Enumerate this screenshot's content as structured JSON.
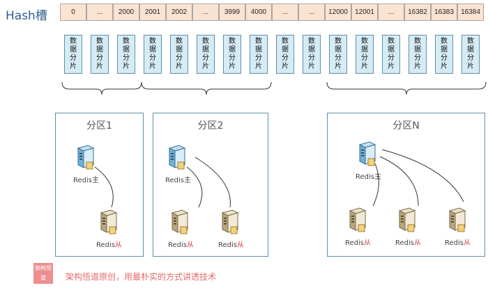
{
  "title": "Hash槽",
  "slots": [
    "0",
    "...",
    "2000",
    "2001",
    "2002",
    "...",
    "3999",
    "4000",
    "...",
    "...",
    "12000",
    "12001",
    "...",
    "16382",
    "16383",
    "16384"
  ],
  "fragment_label": "数据分片",
  "partitions": [
    {
      "name": "分区1",
      "master": {
        "name": "Redis",
        "role": "主"
      },
      "slaves": [
        {
          "name": "Redis",
          "role": "从"
        }
      ]
    },
    {
      "name": "分区2",
      "master": {
        "name": "Redis",
        "role": "主"
      },
      "slaves": [
        {
          "name": "Redis",
          "role": "从"
        },
        {
          "name": "Redis",
          "role": "从"
        }
      ]
    },
    {
      "name": "分区N",
      "master": {
        "name": "Redis",
        "role": "主"
      },
      "slaves": [
        {
          "name": "Redis",
          "role": "从"
        },
        {
          "name": "Redis",
          "role": "从"
        },
        {
          "name": "Redis",
          "role": "从"
        }
      ]
    }
  ],
  "footer": {
    "badge": "架构悟道",
    "text": "架构悟道原创，用最朴实的方式讲透技术"
  }
}
